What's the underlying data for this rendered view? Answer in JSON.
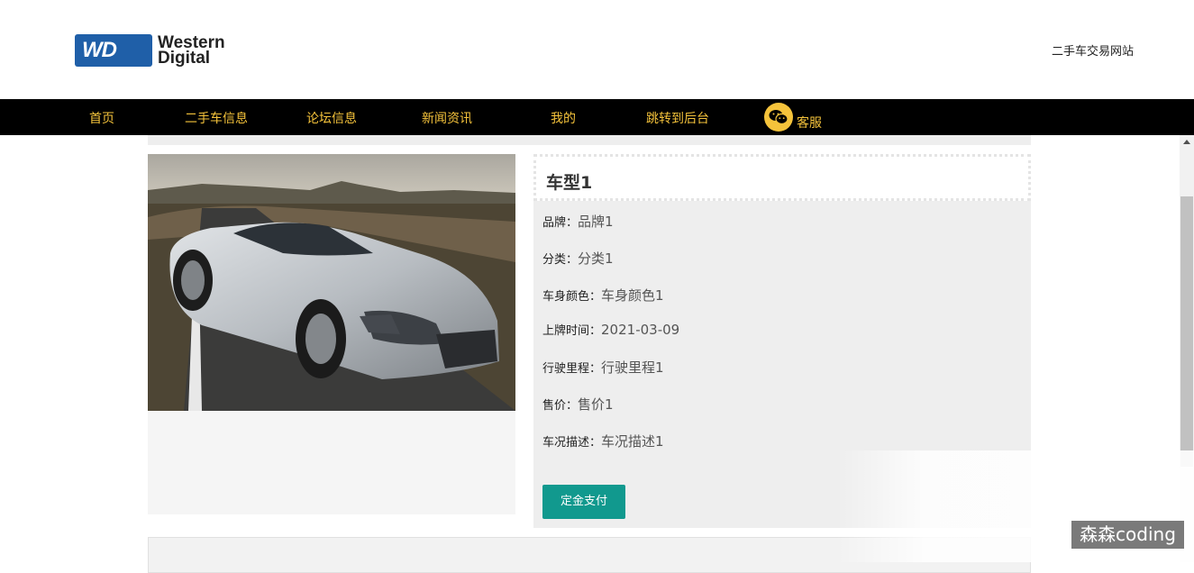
{
  "header": {
    "logo_line1": "Western",
    "logo_line2": "Digital",
    "logo_mark": "WD",
    "site_title": "二手车交易网站"
  },
  "nav": {
    "items": [
      {
        "label": "首页"
      },
      {
        "label": "二手车信息"
      },
      {
        "label": "论坛信息"
      },
      {
        "label": "新闻资讯"
      },
      {
        "label": "我的"
      },
      {
        "label": "跳转到后台"
      }
    ],
    "service_icon": "wechat-icon",
    "service_label": "客服",
    "text_color": "#f5c33b",
    "background": "#000000"
  },
  "detail": {
    "title": "车型1",
    "fields": [
      {
        "label": "品牌：",
        "value": "品牌1"
      },
      {
        "label": "分类：",
        "value": "分类1"
      },
      {
        "label": "车身颜色：",
        "value": "车身颜色1"
      },
      {
        "label": "上牌时间：",
        "value": "2021-03-09"
      },
      {
        "label": "行驶里程：",
        "value": "行驶里程1"
      },
      {
        "label": "售价：",
        "value": "售价1"
      },
      {
        "label": "车况描述：",
        "value": "车况描述1"
      }
    ],
    "pay_button": "定金支付",
    "button_color": "#11998e"
  },
  "watermark": "森森coding"
}
